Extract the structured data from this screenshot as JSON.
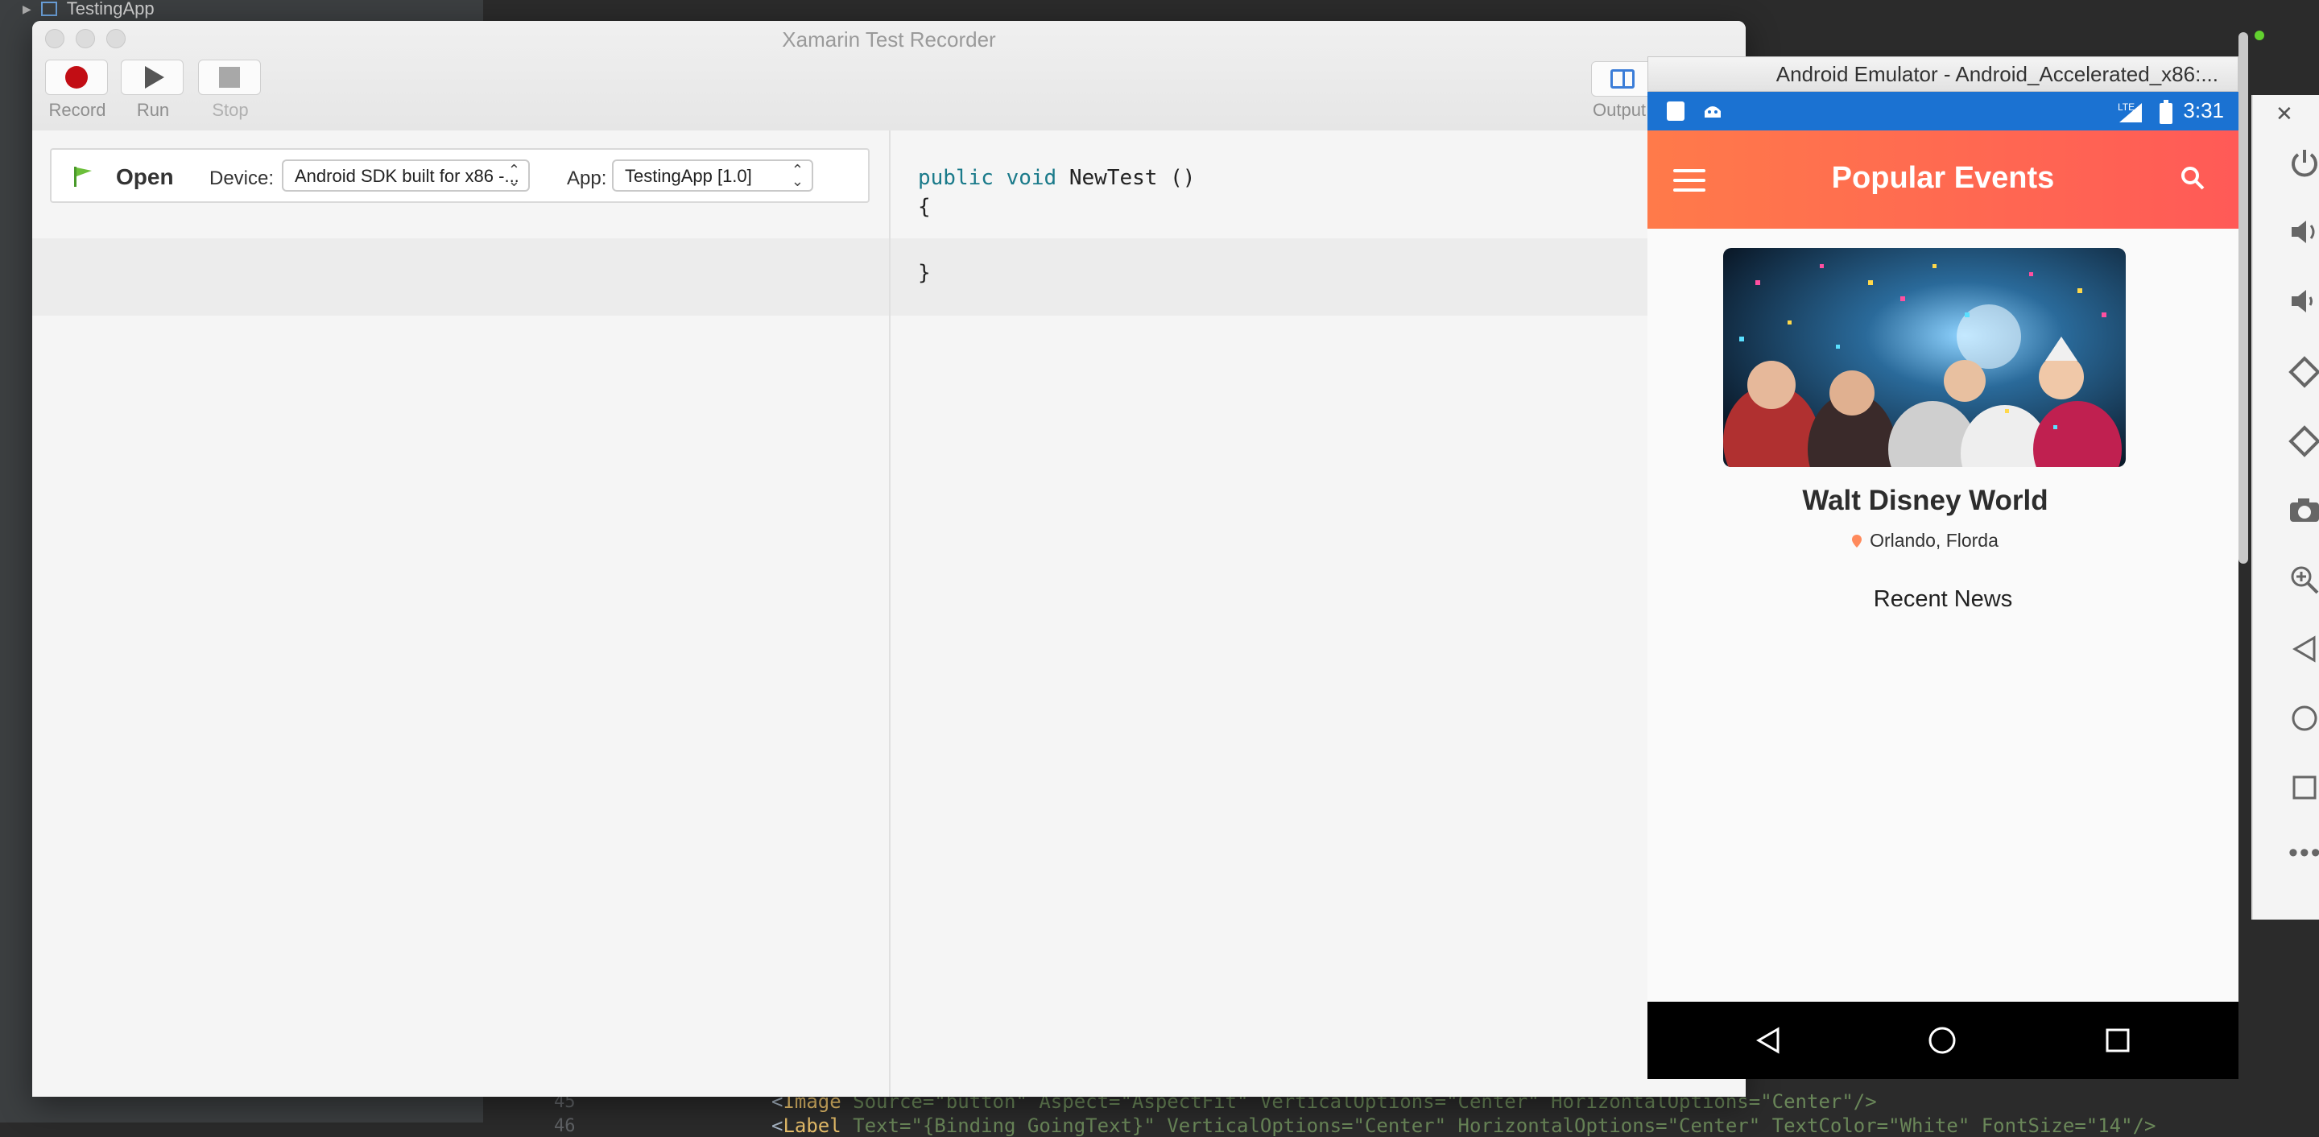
{
  "ide": {
    "tree_item": "TestingApp",
    "code_lines": [
      {
        "num": "45",
        "tag": "Image",
        "rest": " Source=\"button\" Aspect=\"AspectFit\" VerticalOptions=\"Center\" HorizontalOptions=\"Center\"/>"
      },
      {
        "num": "46",
        "tag": "Label",
        "rest": " Text=\"{Binding GoingText}\" VerticalOptions=\"Center\" HorizontalOptions=\"Center\" TextColor=\"White\" FontSize=\"14\"/>"
      }
    ]
  },
  "recorder": {
    "title": "Xamarin Test Recorder",
    "toolbar": {
      "record_label": "Record",
      "run_label": "Run",
      "stop_label": "Stop",
      "output_label": "Output"
    },
    "open_bar": {
      "open_label": "Open",
      "device_label": "Device:",
      "device_value": "Android SDK built for x86 -...",
      "app_label": "App:",
      "app_value": "TestingApp [1.0]"
    },
    "code": {
      "keyword1": "public",
      "keyword2": "void",
      "method": "NewTest ()",
      "open_brace": "{",
      "close_brace": "}"
    }
  },
  "emulator": {
    "window_title": "Android Emulator - Android_Accelerated_x86:...",
    "status": {
      "time": "3:31",
      "network": "LTE"
    },
    "app_title": "Popular Events",
    "event": {
      "name": "Walt Disney World",
      "location": "Orlando, Florda"
    },
    "section_title": "Recent News",
    "colors": {
      "status_bar": "#1b72d2",
      "app_bar_start": "#ff7a4a",
      "app_bar_end": "#ff5a57",
      "pin": "#ff8a5c"
    }
  },
  "side_panel": {
    "icons": [
      "power-icon",
      "volume-up-icon",
      "volume-down-icon",
      "rotate-left-icon",
      "rotate-right-icon",
      "camera-icon",
      "zoom-icon",
      "back-icon",
      "home-icon",
      "overview-icon",
      "more-icon"
    ]
  }
}
